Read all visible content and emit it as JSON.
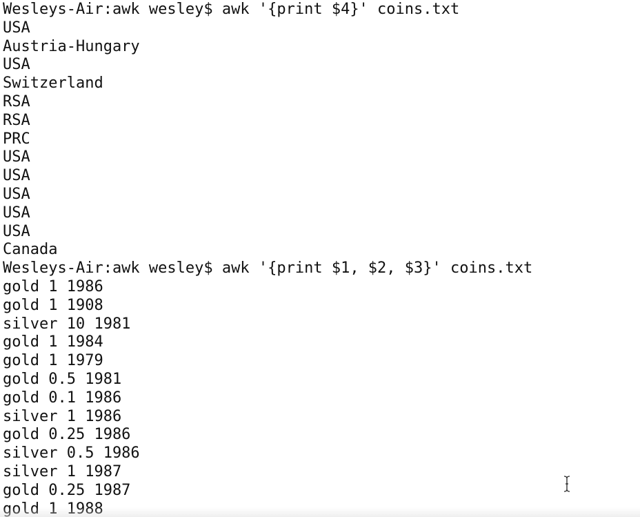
{
  "terminal": {
    "lines": [
      "Wesleys-Air:awk wesley$ awk '{print $4}' coins.txt",
      "USA",
      "Austria-Hungary",
      "USA",
      "Switzerland",
      "RSA",
      "RSA",
      "PRC",
      "USA",
      "USA",
      "USA",
      "USA",
      "USA",
      "Canada",
      "Wesleys-Air:awk wesley$ awk '{print $1, $2, $3}' coins.txt",
      "gold 1 1986",
      "gold 1 1908",
      "silver 10 1981",
      "gold 1 1984",
      "gold 1 1979",
      "gold 0.5 1981",
      "gold 0.1 1986",
      "silver 1 1986",
      "gold 0.25 1986",
      "silver 0.5 1986",
      "silver 1 1987",
      "gold 0.25 1987",
      "gold 1 1988"
    ]
  },
  "icons": {
    "cursor": "text-i-beam-cursor-icon"
  },
  "colors": {
    "background": "#ffffff",
    "text": "#111111"
  }
}
